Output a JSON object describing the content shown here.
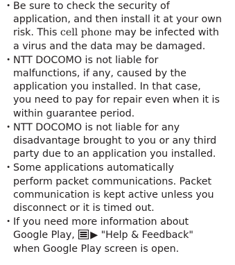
{
  "notes": [
    {
      "lines": [
        "Be sure to check the security of",
        "application, and then install it at your own",
        [
          "risk. This ",
          "cell phone",
          " may be infected with"
        ],
        "a virus and the data may be damaged."
      ]
    },
    {
      "lines": [
        "NTT DOCOMO is not liable for",
        "malfunctions, if any, caused by the",
        "application you installed. In that case,",
        "you need to pay for repair even when it is",
        "within guarantee period."
      ]
    },
    {
      "lines": [
        "NTT DOCOMO is not liable for any",
        "disadvantage brought to you or any third",
        "party due to an application you installed."
      ]
    },
    {
      "lines": [
        "Some applications automatically",
        "perform packet communications. Packet",
        "communication is kept active unless you",
        "disconnect or it is timed out."
      ]
    },
    {
      "lines": [
        "If you need more information about",
        [
          "Google Play, ",
          "▶ \"Help & Feedback\""
        ],
        "when Google Play screen is open."
      ]
    }
  ],
  "bullet_glyph": "・",
  "icons": {
    "menu": "menu-icon"
  },
  "colors": {
    "text": "#231f20",
    "icon": "#231f20"
  }
}
